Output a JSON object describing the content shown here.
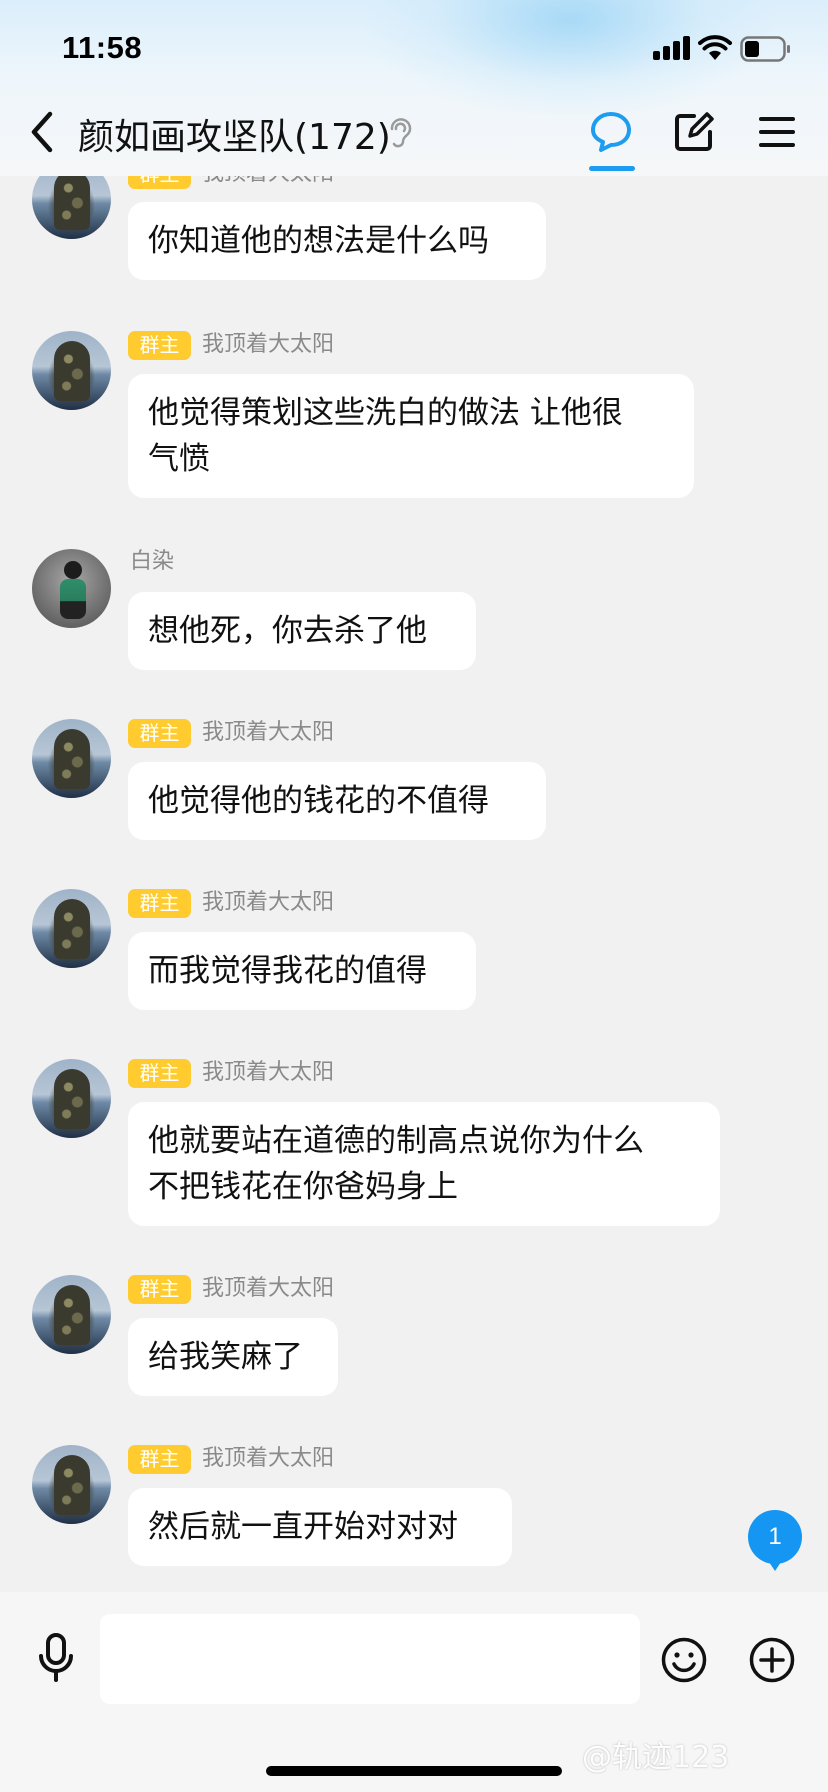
{
  "status_bar": {
    "time": "11:58"
  },
  "header": {
    "title": "颜如画攻坚队(172)"
  },
  "owner_badge": "群主",
  "messages": [
    {
      "sender": "我顶着大太阳",
      "badge": "群主",
      "text_lines": [
        "你知道他的想法是什么吗"
      ]
    },
    {
      "sender": "我顶着大太阳",
      "badge": "群主",
      "text_lines": [
        "他觉得策划这些洗白的做法 让他很",
        "气愤"
      ]
    },
    {
      "sender": "白染",
      "badge": "",
      "text_lines": [
        "想他死，你去杀了他"
      ]
    },
    {
      "sender": "我顶着大太阳",
      "badge": "群主",
      "text_lines": [
        "他觉得他的钱花的不值得"
      ]
    },
    {
      "sender": "我顶着大太阳",
      "badge": "群主",
      "text_lines": [
        "而我觉得我花的值得"
      ]
    },
    {
      "sender": "我顶着大太阳",
      "badge": "群主",
      "text_lines": [
        "他就要站在道德的制高点说你为什么",
        "不把钱花在你爸妈身上"
      ]
    },
    {
      "sender": "我顶着大太阳",
      "badge": "群主",
      "text_lines": [
        "给我笑麻了"
      ]
    },
    {
      "sender": "我顶着大太阳",
      "badge": "群主",
      "text_lines": [
        "然后就一直开始对对对"
      ]
    }
  ],
  "unread_count": "1",
  "input": {
    "placeholder": ""
  },
  "watermark": "@轨迹123",
  "colors": {
    "accent": "#1e9cf0",
    "badge": "#ffcb2e",
    "bubble": "#ffffff",
    "background": "#f1f1f1"
  },
  "icons": [
    "back-icon",
    "ear-icon",
    "chat-icon",
    "edit-icon",
    "menu-icon",
    "mic-icon",
    "emoji-icon",
    "plus-icon"
  ]
}
